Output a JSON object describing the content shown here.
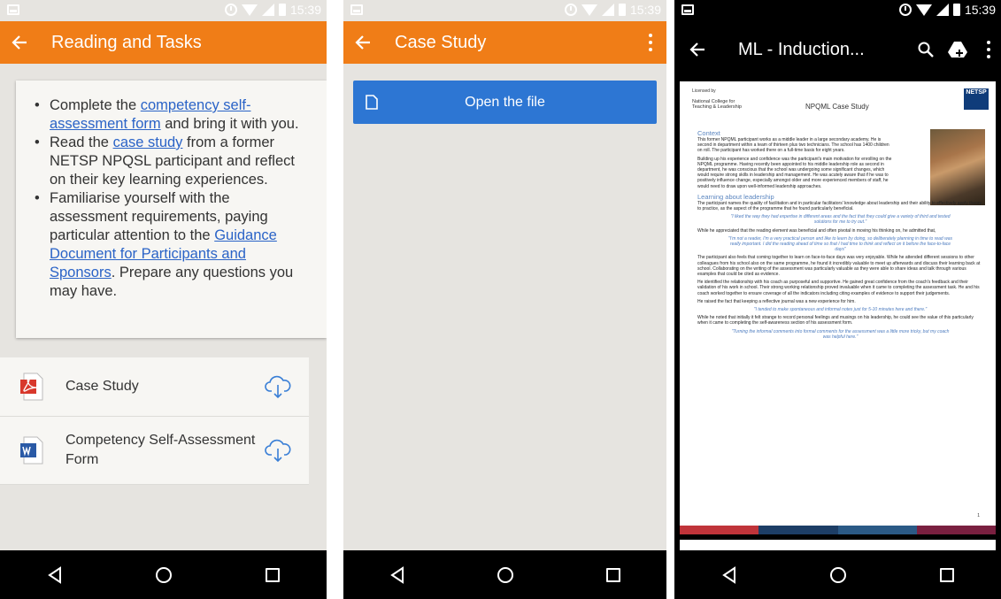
{
  "status": {
    "time": "15:39"
  },
  "panel1": {
    "title": "Reading and Tasks",
    "bullets": [
      {
        "pre": "Complete the ",
        "link": "competency self-assessment form",
        "post": " and bring it with you."
      },
      {
        "pre": "Read the ",
        "link": "case study",
        "post": " from a former NETSP NPQSL participant and reflect on their key learning experiences."
      },
      {
        "pre": "Familiarise yourself with the assessment requirements, paying particular attention to the ",
        "link": "Guidance Document for Participants and Sponsors",
        "post": ". Prepare any questions you may have."
      }
    ],
    "files": [
      {
        "name": "Case Study",
        "type": "pdf"
      },
      {
        "name": "Competency Self-Assessment Form",
        "type": "word"
      }
    ]
  },
  "panel2": {
    "title": "Case Study",
    "open_label": "Open the file"
  },
  "panel3": {
    "title": "ML - Induction...",
    "doc": {
      "licensed": "Licensed by",
      "college": "National College for Teaching & Leadership",
      "title": "NPQML Case Study",
      "logo": "NETSP",
      "context_heading": "Context",
      "context_p1": "This former NPQML participant works as a middle leader in a large secondary academy. He is second in department within a team of thirteen plus two technicians. The school has 1400 children on roll. The participant has worked there on a full-time basis for eight years.",
      "context_p2": "Building up his experience and confidence was the participant's main motivation for enrolling on the NPQML programme. Having recently been appointed to his middle leadership role as second in department, he was conscious that the school was undergoing some significant changes, which would require strong skills in leadership and management. He was acutely aware that if he was to positively influence change, especially amongst older and more experienced members of staff, he would need to draw upon well-informed leadership approaches.",
      "learning_heading": "Learning about leadership",
      "learning_p1": "The participant names the quality of facilitation and in particular facilitators' knowledge about leadership and their ability to effectively apply theory to practice, as the aspect of the programme that he found particularly beneficial.",
      "quote1": "\"I liked the way they had expertise in different areas and the fact that they could give a variety of third and tested solutions for me to try out.\"",
      "learning_p2": "While he appreciated that the reading element was beneficial and often pivotal in moving his thinking on, he admitted that,",
      "quote2": "\"I'm not a reader, I'm a very practical person and like to learn by doing, so deliberately planning in time to read was really important. I did the reading ahead of time so that I had time to think and reflect on it before the face-to-face days\"",
      "learning_p3": "The participant also feels that coming together to learn on face-to-face days was very enjoyable. While he attended different sessions to other colleagues from his school also on the same programme, he found it incredibly valuable to meet up afterwards and discuss their learning back at school. Collaborating on the writing of the assessment was particularly valuable as they were able to share ideas and talk through various examples that could be cited as evidence.",
      "learning_p4": "He identified the relationship with his coach as purposeful and supportive. He gained great confidence from the coach's feedback and their validation of his work in school. Their strong working relationship proved invaluable when it came to completing the assessment task. He and his coach worked together to ensure coverage of all the indicators including citing examples of evidence to support their judgements.",
      "learning_p5": "He raised the fact that keeping a reflective journal was a new experience for him.",
      "quote3": "\"I tended to make spontaneous and informal notes just for 5-10 minutes here and there.\"",
      "learning_p6": "While he noted that initially it felt strange to record personal feelings and musings on his leadership, he could see the value of this particularly when it came to completing the self-awareness section of his assessment form.",
      "quote4": "\"Turning the informal comments into formal comments for the assessment was a little more tricky, but my coach was helpful here.\"",
      "page_number": "1"
    }
  },
  "colors": {
    "appbar": "#f07d17",
    "button": "#2d76d3",
    "link": "#2a63c7",
    "doc_bar": [
      "#c0343a",
      "#1d3e66",
      "#2b5a86",
      "#7a2040"
    ]
  }
}
